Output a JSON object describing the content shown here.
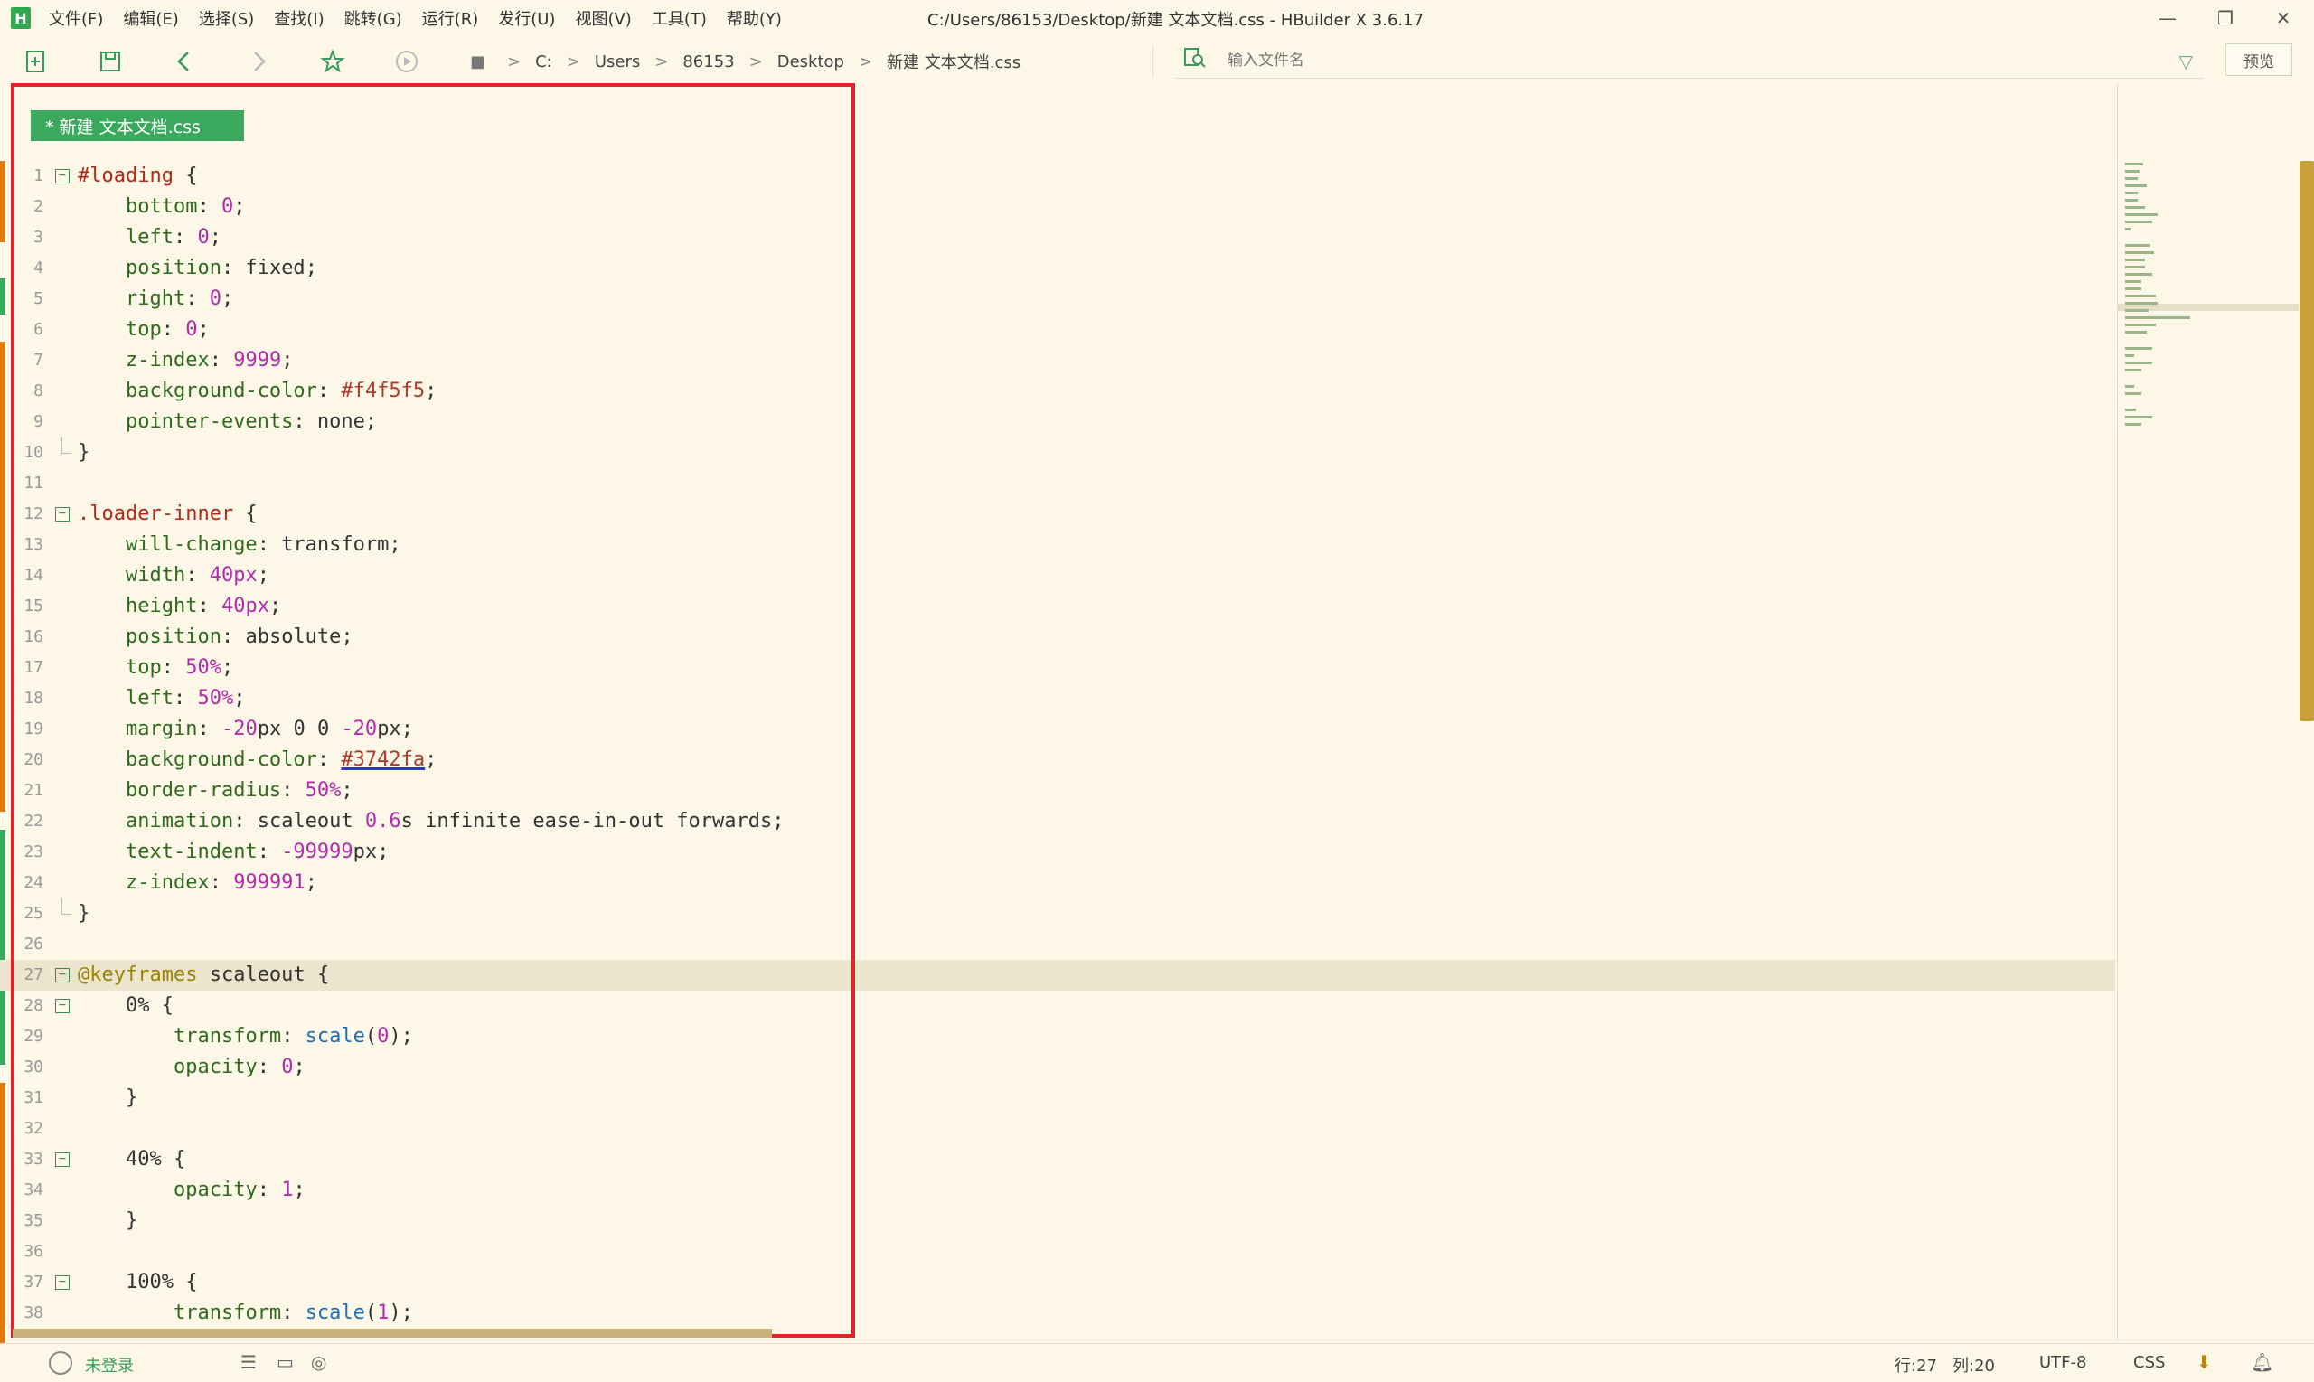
{
  "window": {
    "title": "C:/Users/86153/Desktop/新建 文本文档.css - HBuilder X 3.6.17",
    "app_icon": "H"
  },
  "menu": [
    "文件(F)",
    "编辑(E)",
    "选择(S)",
    "查找(I)",
    "跳转(G)",
    "运行(R)",
    "发行(U)",
    "视图(V)",
    "工具(T)",
    "帮助(Y)"
  ],
  "breadcrumb": [
    "C:",
    "Users",
    "86153",
    "Desktop",
    "新建 文本文档.css"
  ],
  "search": {
    "placeholder": "输入文件名"
  },
  "preview_label": "预览",
  "tab": {
    "label": "* 新建 文本文档.css"
  },
  "code_lines": [
    "1",
    "2",
    "3",
    "4",
    "5",
    "6",
    "7",
    "8",
    "9",
    "10",
    "11",
    "12",
    "13",
    "14",
    "15",
    "16",
    "17",
    "18",
    "19",
    "20",
    "21",
    "22",
    "23",
    "24",
    "25",
    "26",
    "27",
    "28",
    "29",
    "30",
    "31",
    "32",
    "33",
    "34",
    "35",
    "36",
    "37",
    "38"
  ],
  "code": {
    "l1_sel": "#loading",
    "l1_rest": " {",
    "l2": [
      "bottom",
      "0"
    ],
    "l3": [
      "left",
      "0"
    ],
    "l4": [
      "position",
      "fixed"
    ],
    "l5": [
      "right",
      "0"
    ],
    "l6": [
      "top",
      "0"
    ],
    "l7": [
      "z-index",
      "9999"
    ],
    "l8": [
      "background-color",
      "#f4f5f5"
    ],
    "l9": [
      "pointer-events",
      "none"
    ],
    "l12_sel": ".loader-inner",
    "l13": [
      "will-change",
      "transform"
    ],
    "l14": [
      "width",
      "40",
      "px"
    ],
    "l15": [
      "height",
      "40",
      "px"
    ],
    "l16": [
      "position",
      "absolute"
    ],
    "l17": [
      "top",
      "50",
      "%"
    ],
    "l18": [
      "left",
      "50",
      "%"
    ],
    "l19_prop": "margin",
    "l19_a": "-20",
    "l19_b": "px 0 0 ",
    "l19_c": "-20",
    "l19_d": "px",
    "l20": [
      "background-color",
      "#3742fa"
    ],
    "l21": [
      "border-radius",
      "50",
      "%"
    ],
    "l22_prop": "animation",
    "l22_a": "scaleout ",
    "l22_num": "0.6",
    "l22_b": "s infinite ease-in-out forwards",
    "l23": [
      "text-indent",
      "-99999",
      "px"
    ],
    "l24": [
      "z-index",
      "999991"
    ],
    "l27_at": "@keyframes",
    "l27_rest": " scaleout {",
    "l28": "0% {",
    "l29_prop": "transform",
    "l29_fn": "scale",
    "l29_arg": "0",
    "l30": [
      "opacity",
      "0"
    ],
    "l33": "40% {",
    "l34": [
      "opacity",
      "1"
    ],
    "l37": "100% {",
    "l38_prop": "transform",
    "l38_fn": "scale",
    "l38_arg": "1"
  },
  "status": {
    "login": "未登录",
    "position": "行:27",
    "column": "列:20",
    "encoding": "UTF-8",
    "language": "CSS"
  },
  "colors": {
    "accent": "#3aa95d",
    "highlight_box": "#e0252c",
    "background": "#fcf7e6"
  }
}
